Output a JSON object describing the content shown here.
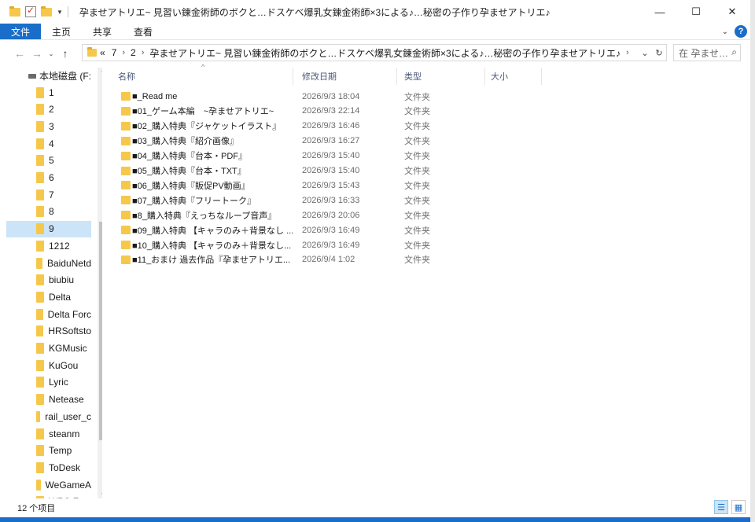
{
  "window": {
    "title": "孕ませアトリエ~ 見習い錬金術師のボクと…ドスケベ爆乳女錬金術師×3による♪…秘密の子作り孕ませアトリエ♪",
    "minimize": "—",
    "maximize": "☐",
    "close": "✕"
  },
  "ribbon": {
    "tabs": [
      "文件",
      "主页",
      "共享",
      "查看"
    ],
    "help": "?"
  },
  "nav": {
    "back": "←",
    "forward": "→",
    "recent": "⌄",
    "up": "↑",
    "breadcrumb": [
      "«",
      "7",
      "2",
      "孕ませアトリエ~ 見習い錬金術師のボクと…ドスケベ爆乳女錬金術師×3による♪…秘密の子作り孕ませアトリエ♪"
    ],
    "dropdown": "⌄",
    "refresh": "↻",
    "search_placeholder": "在 孕ませ…",
    "search_icon": "⌕"
  },
  "sidebar": {
    "drive": "本地磁盘 (F:",
    "items": [
      "1",
      "2",
      "3",
      "4",
      "5",
      "6",
      "7",
      "8",
      "9",
      "1212",
      "BaiduNetd",
      "biubiu",
      "Delta",
      "Delta Forc",
      "HRSoftsto",
      "KGMusic",
      "KuGou",
      "Lyric",
      "Netease",
      "rail_user_c",
      "steanm",
      "Temp",
      "ToDesk",
      "WeGameA",
      "WPS F..."
    ],
    "selected": "9",
    "scroll_up": "⌃",
    "scroll_down": "⌄"
  },
  "columns": {
    "name": "名称",
    "date": "修改日期",
    "type": "类型",
    "size": "大小",
    "sort_indicator": "^"
  },
  "files": [
    {
      "name": "■_Read me",
      "date": "2026/9/3 18:04",
      "type": "文件夹"
    },
    {
      "name": "■01_ゲーム本編　~孕ませアトリエ~",
      "date": "2026/9/3 22:14",
      "type": "文件夹"
    },
    {
      "name": "■02_購入特典『ジャケットイラスト』",
      "date": "2026/9/3 16:46",
      "type": "文件夹"
    },
    {
      "name": "■03_購入特典『紹介画像』",
      "date": "2026/9/3 16:27",
      "type": "文件夹"
    },
    {
      "name": "■04_購入特典『台本・PDF』",
      "date": "2026/9/3 15:40",
      "type": "文件夹"
    },
    {
      "name": "■05_購入特典『台本・TXT』",
      "date": "2026/9/3 15:40",
      "type": "文件夹"
    },
    {
      "name": "■06_購入特典『販促PV動画』",
      "date": "2026/9/3 15:43",
      "type": "文件夹"
    },
    {
      "name": "■07_購入特典『フリートーク』",
      "date": "2026/9/3 16:33",
      "type": "文件夹"
    },
    {
      "name": "■8_購入特典『えっちなループ音声』",
      "date": "2026/9/3 20:06",
      "type": "文件夹"
    },
    {
      "name": "■09_購入特典 【キャラのみ＋背景なし ...",
      "date": "2026/9/3 16:49",
      "type": "文件夹"
    },
    {
      "name": "■10_購入特典 【キャラのみ＋背景なし...",
      "date": "2026/9/3 16:49",
      "type": "文件夹"
    },
    {
      "name": "■11_おまけ 過去作品『孕ませアトリエ...",
      "date": "2026/9/4 1:02",
      "type": "文件夹"
    }
  ],
  "status": {
    "count": "12 个项目",
    "details_view": "☰",
    "tiles_view": "▦"
  }
}
